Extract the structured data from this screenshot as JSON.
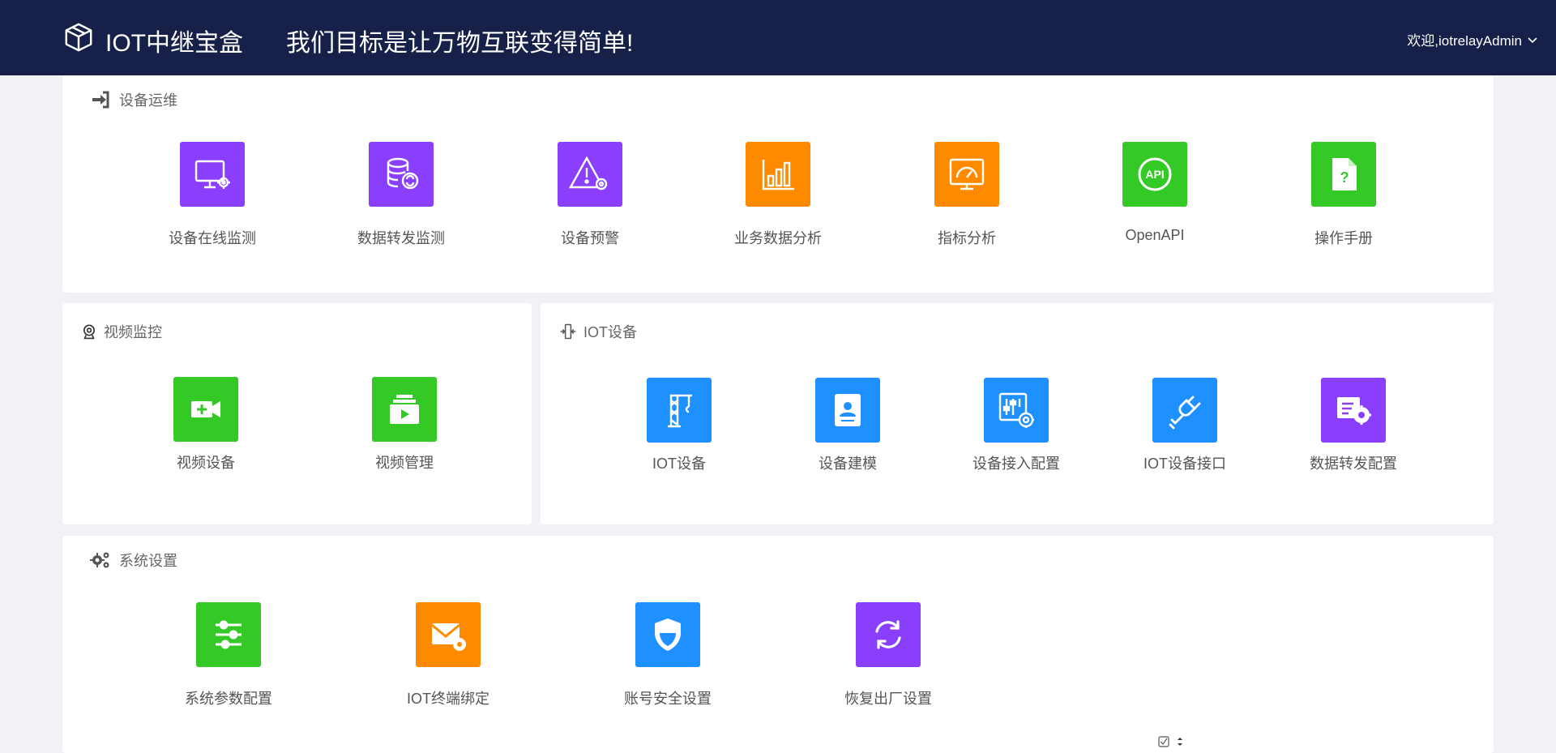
{
  "header": {
    "app_title": "IOT中继宝盒",
    "slogan": "我们目标是让万物互联变得简单!",
    "user_greeting": "欢迎,iotrelayAdmin"
  },
  "colors": {
    "header_bg": "#172048",
    "page_bg": "#f0f2f5",
    "purple": "#8a3ffc",
    "orange": "#ff8a00",
    "green": "#35c927",
    "blue": "#1e90ff"
  },
  "sections": {
    "ops": {
      "title": "设备运维",
      "title_icon": "sign-in-icon",
      "items": [
        {
          "label": "设备在线监测",
          "icon": "monitor-gear-icon",
          "color": "purple"
        },
        {
          "label": "数据转发监测",
          "icon": "database-sync-icon",
          "color": "purple"
        },
        {
          "label": "设备预警",
          "icon": "warning-gear-icon",
          "color": "purple"
        },
        {
          "label": "业务数据分析",
          "icon": "bar-chart-icon",
          "color": "orange"
        },
        {
          "label": "指标分析",
          "icon": "gauge-icon",
          "color": "orange"
        },
        {
          "label": "OpenAPI",
          "icon": "api-icon",
          "color": "green"
        },
        {
          "label": "操作手册",
          "icon": "help-document-icon",
          "color": "green"
        }
      ]
    },
    "video": {
      "title": "视频监控",
      "title_icon": "webcam-icon",
      "items": [
        {
          "label": "视频设备",
          "icon": "video-camera-icon",
          "color": "green"
        },
        {
          "label": "视频管理",
          "icon": "video-library-icon",
          "color": "green"
        }
      ]
    },
    "iot": {
      "title": "IOT设备",
      "title_icon": "iot-device-icon",
      "items": [
        {
          "label": "IOT设备",
          "icon": "crane-icon",
          "color": "blue"
        },
        {
          "label": "设备建模",
          "icon": "model-icon",
          "color": "blue"
        },
        {
          "label": "设备接入配置",
          "icon": "config-sliders-gear-icon",
          "color": "blue"
        },
        {
          "label": "IOT设备接口",
          "icon": "plug-connect-icon",
          "color": "blue"
        },
        {
          "label": "数据转发配置",
          "icon": "forward-config-gear-icon",
          "color": "purple"
        }
      ]
    },
    "system": {
      "title": "系统设置",
      "title_icon": "gears-icon",
      "items": [
        {
          "label": "系统参数配置",
          "icon": "sliders-icon",
          "color": "green"
        },
        {
          "label": "IOT终端绑定",
          "icon": "mail-gear-icon",
          "color": "orange"
        },
        {
          "label": "账号安全设置",
          "icon": "shield-icon",
          "color": "blue"
        },
        {
          "label": "恢复出厂设置",
          "icon": "reset-icon",
          "color": "purple"
        }
      ]
    }
  }
}
